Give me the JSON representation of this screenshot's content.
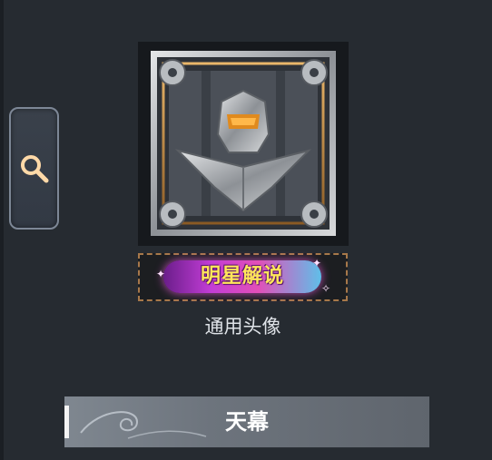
{
  "search": {
    "icon": "search-icon"
  },
  "avatar": {
    "icon": "mech-helmet-avatar"
  },
  "badge": {
    "label": "明星解说"
  },
  "caption": "通用头像",
  "title_bar": {
    "label": "天幕"
  },
  "colors": {
    "background": "#262b31",
    "badge_text": "#ffe65a",
    "badge_glow": "#e24fb8",
    "badge_border": "#a7784a",
    "title_bar": "#6d747d"
  }
}
